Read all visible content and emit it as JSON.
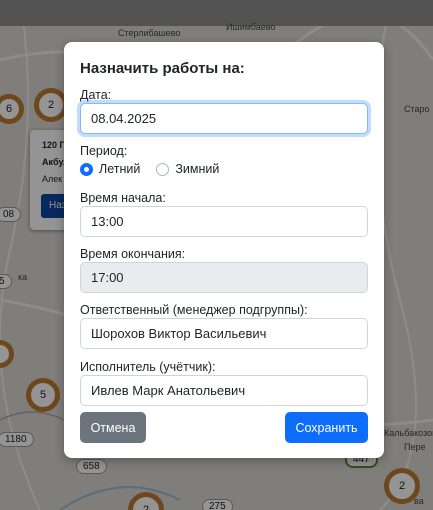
{
  "map": {
    "places": [
      "Стерлибашево",
      "Ишимбаево",
      "Старо",
      "Пере",
      "Кальбакозово",
      "ва",
      "ка"
    ],
    "clusters": [
      "6",
      "2",
      "5",
      "2",
      "2"
    ],
    "pills": [
      "08",
      "1180",
      "658",
      "275",
      "447",
      "5"
    ],
    "popup": {
      "line1": "120 П",
      "line2": "Акбул",
      "line3": "Алек",
      "button": "Наз"
    }
  },
  "modal": {
    "title": "Назначить работы на:",
    "date_label": "Дата:",
    "date_value": "08.04.2025",
    "period_label": "Период:",
    "period_options": [
      {
        "label": "Летний",
        "checked": true
      },
      {
        "label": "Зимний",
        "checked": false
      }
    ],
    "start_label": "Время начала:",
    "start_value": "13:00",
    "end_label": "Время окончания:",
    "end_value": "17:00",
    "responsible_label": "Ответственный (менеджер подгруппы):",
    "responsible_value": "Шорохов Виктор Васильевич",
    "executor_label": "Исполнитель (учётчик):",
    "executor_value": "Ивлев Марк Анатольевич",
    "cancel_label": "Отмена",
    "save_label": "Сохранить"
  },
  "colors": {
    "primary": "#0d6efd",
    "secondary": "#6c757d",
    "cluster_orange": "#c07a33",
    "cluster_green": "#5c9c3d"
  }
}
